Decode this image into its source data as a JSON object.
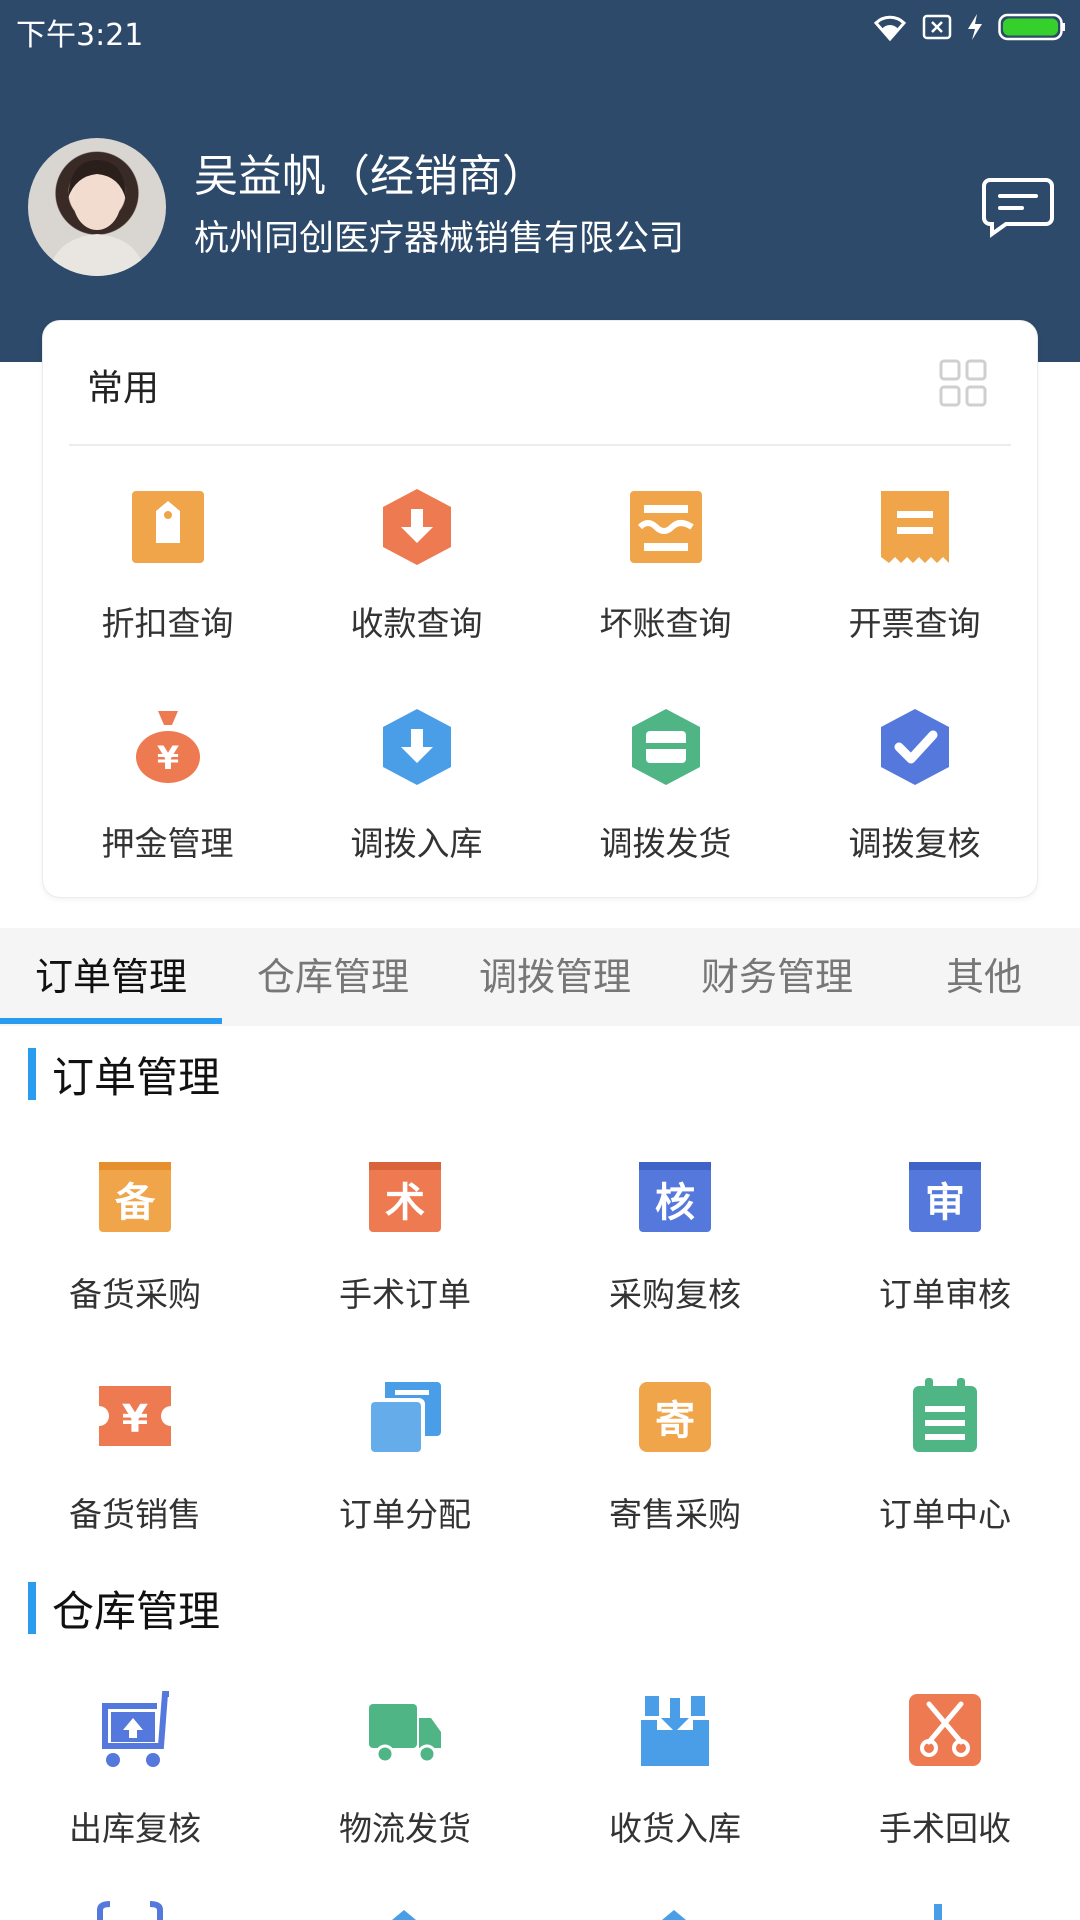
{
  "status_bar": {
    "time": "下午3:21"
  },
  "profile": {
    "name": "吴益帆（经销商）",
    "company": "杭州同创医疗器械销售有限公司"
  },
  "common": {
    "title": "常用",
    "items": [
      {
        "label": "折扣查询",
        "icon": "discount-tag-icon",
        "color": "#f0a54a"
      },
      {
        "label": "收款查询",
        "icon": "download-hexagon-icon",
        "color": "#ee7a51"
      },
      {
        "label": "坏账查询",
        "icon": "bad-debt-icon",
        "color": "#f0a54a"
      },
      {
        "label": "开票查询",
        "icon": "invoice-receipt-icon",
        "color": "#f0a54a"
      },
      {
        "label": "押金管理",
        "icon": "money-bag-icon",
        "color": "#ee7a51"
      },
      {
        "label": "调拨入库",
        "icon": "inbound-hexagon-icon",
        "color": "#4a9ee8"
      },
      {
        "label": "调拨发货",
        "icon": "shipping-box-icon",
        "color": "#4fb585"
      },
      {
        "label": "调拨复核",
        "icon": "check-hexagon-icon",
        "color": "#5578dc"
      }
    ]
  },
  "tabs": [
    {
      "label": "订单管理",
      "active": true
    },
    {
      "label": "仓库管理",
      "active": false
    },
    {
      "label": "调拨管理",
      "active": false
    },
    {
      "label": "财务管理",
      "active": false
    },
    {
      "label": "其他",
      "active": false
    }
  ],
  "sections": [
    {
      "title": "订单管理",
      "items": [
        {
          "label": "备货采购",
          "icon": "stock-purchase-icon",
          "glyph": "备",
          "color": "#f0a54a"
        },
        {
          "label": "手术订单",
          "icon": "surgery-order-icon",
          "glyph": "术",
          "color": "#ee7a51"
        },
        {
          "label": "采购复核",
          "icon": "purchase-review-icon",
          "glyph": "核",
          "color": "#5578dc"
        },
        {
          "label": "订单审核",
          "icon": "order-audit-icon",
          "glyph": "审",
          "color": "#5578dc"
        },
        {
          "label": "备货销售",
          "icon": "stock-sales-icon",
          "glyph": "¥",
          "color": "#ee7a51"
        },
        {
          "label": "订单分配",
          "icon": "order-assign-icon",
          "glyph": "",
          "color": "#4a9ee8"
        },
        {
          "label": "寄售采购",
          "icon": "consignment-purchase-icon",
          "glyph": "寄",
          "color": "#f0a54a"
        },
        {
          "label": "订单中心",
          "icon": "order-center-icon",
          "glyph": "",
          "color": "#4fb585"
        }
      ]
    },
    {
      "title": "仓库管理",
      "items": [
        {
          "label": "出库复核",
          "icon": "outbound-cart-icon",
          "color": "#5578dc"
        },
        {
          "label": "物流发货",
          "icon": "delivery-truck-icon",
          "color": "#4fb585"
        },
        {
          "label": "收货入库",
          "icon": "receive-tray-icon",
          "color": "#4a9ee8"
        },
        {
          "label": "手术回收",
          "icon": "scissors-recycle-icon",
          "color": "#ee7a51"
        }
      ]
    }
  ]
}
